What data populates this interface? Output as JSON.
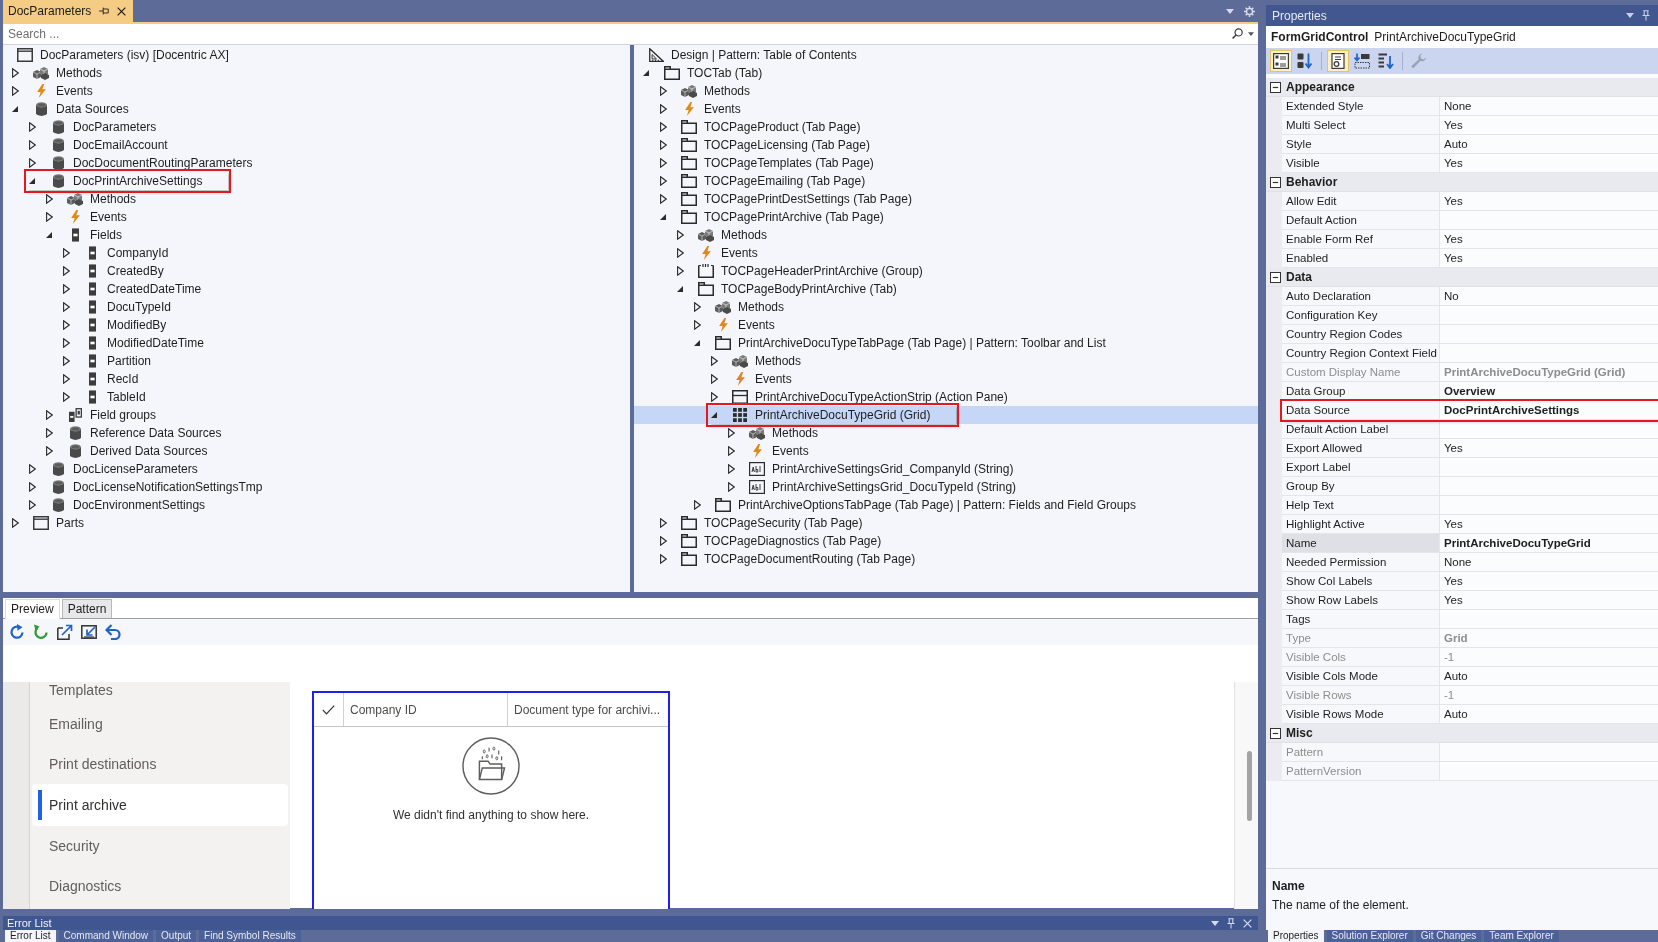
{
  "document_tabs": [
    {
      "label": "DocParameters",
      "selected": true
    }
  ],
  "search": {
    "placeholder": "Search ..."
  },
  "left_tree": {
    "root": {
      "label": "DocParameters (isv) [Docentric AX]",
      "kind": "window"
    },
    "items": [
      {
        "label": "Methods",
        "kind": "methods",
        "expanded": false,
        "selected": false,
        "highlighted": false
      },
      {
        "label": "Events",
        "kind": "events",
        "expanded": false,
        "selected": false,
        "highlighted": false
      },
      {
        "label": "Data Sources",
        "kind": "datasource",
        "expanded": true,
        "selected": false,
        "highlighted": false,
        "children": [
          {
            "label": "DocParameters",
            "kind": "datasource",
            "expanded": false,
            "selected": false,
            "highlighted": false
          },
          {
            "label": "DocEmailAccount",
            "kind": "datasource",
            "expanded": false,
            "selected": false,
            "highlighted": false
          },
          {
            "label": "DocDocumentRoutingParameters",
            "kind": "datasource",
            "expanded": false,
            "selected": false,
            "highlighted": false
          },
          {
            "label": "DocPrintArchiveSettings",
            "kind": "datasource",
            "expanded": true,
            "selected": false,
            "highlighted": true,
            "children": [
              {
                "label": "Methods",
                "kind": "methods",
                "expanded": false,
                "selected": false,
                "highlighted": false
              },
              {
                "label": "Events",
                "kind": "events",
                "expanded": false,
                "selected": false,
                "highlighted": false
              },
              {
                "label": "Fields",
                "kind": "field",
                "expanded": true,
                "selected": false,
                "highlighted": false,
                "children": [
                  {
                    "label": "CompanyId",
                    "kind": "field",
                    "expanded": false,
                    "selected": false,
                    "highlighted": false
                  },
                  {
                    "label": "CreatedBy",
                    "kind": "field",
                    "expanded": false,
                    "selected": false,
                    "highlighted": false
                  },
                  {
                    "label": "CreatedDateTime",
                    "kind": "field",
                    "expanded": false,
                    "selected": false,
                    "highlighted": false
                  },
                  {
                    "label": "DocuTypeId",
                    "kind": "field",
                    "expanded": false,
                    "selected": false,
                    "highlighted": false
                  },
                  {
                    "label": "ModifiedBy",
                    "kind": "field",
                    "expanded": false,
                    "selected": false,
                    "highlighted": false
                  },
                  {
                    "label": "ModifiedDateTime",
                    "kind": "field",
                    "expanded": false,
                    "selected": false,
                    "highlighted": false
                  },
                  {
                    "label": "Partition",
                    "kind": "field",
                    "expanded": false,
                    "selected": false,
                    "highlighted": false
                  },
                  {
                    "label": "RecId",
                    "kind": "field",
                    "expanded": false,
                    "selected": false,
                    "highlighted": false
                  },
                  {
                    "label": "TableId",
                    "kind": "field",
                    "expanded": false,
                    "selected": false,
                    "highlighted": false
                  }
                ]
              },
              {
                "label": "Field groups",
                "kind": "fieldgroup",
                "expanded": false,
                "selected": false,
                "highlighted": false
              },
              {
                "label": "Reference Data Sources",
                "kind": "datasource",
                "expanded": false,
                "selected": false,
                "highlighted": false
              },
              {
                "label": "Derived Data Sources",
                "kind": "datasource",
                "expanded": false,
                "selected": false,
                "highlighted": false
              }
            ]
          },
          {
            "label": "DocLicenseParameters",
            "kind": "datasource",
            "expanded": false,
            "selected": false,
            "highlighted": false
          },
          {
            "label": "DocLicenseNotificationSettingsTmp",
            "kind": "datasource",
            "expanded": false,
            "selected": false,
            "highlighted": false
          },
          {
            "label": "DocEnvironmentSettings",
            "kind": "datasource",
            "expanded": false,
            "selected": false,
            "highlighted": false
          }
        ]
      },
      {
        "label": "Parts",
        "kind": "window",
        "expanded": false,
        "selected": false,
        "highlighted": false
      }
    ]
  },
  "right_tree": {
    "root": {
      "label": "Design | Pattern: Table of Contents",
      "kind": "design"
    },
    "items": [
      {
        "label": "TOCTab (Tab)",
        "kind": "folder",
        "expanded": true,
        "selected": false,
        "highlighted": false,
        "children": [
          {
            "label": "Methods",
            "kind": "methods",
            "expanded": false,
            "selected": false,
            "highlighted": false
          },
          {
            "label": "Events",
            "kind": "events",
            "expanded": false,
            "selected": false,
            "highlighted": false
          },
          {
            "label": "TOCPageProduct (Tab Page)",
            "kind": "folder",
            "expanded": false,
            "selected": false,
            "highlighted": false
          },
          {
            "label": "TOCPageLicensing (Tab Page)",
            "kind": "folder",
            "expanded": false,
            "selected": false,
            "highlighted": false
          },
          {
            "label": "TOCPageTemplates (Tab Page)",
            "kind": "folder",
            "expanded": false,
            "selected": false,
            "highlighted": false
          },
          {
            "label": "TOCPageEmailing (Tab Page)",
            "kind": "folder",
            "expanded": false,
            "selected": false,
            "highlighted": false
          },
          {
            "label": "TOCPagePrintDestSettings (Tab Page)",
            "kind": "folder",
            "expanded": false,
            "selected": false,
            "highlighted": false
          },
          {
            "label": "TOCPagePrintArchive (Tab Page)",
            "kind": "folder",
            "expanded": true,
            "selected": false,
            "highlighted": false,
            "children": [
              {
                "label": "Methods",
                "kind": "methods",
                "expanded": false,
                "selected": false,
                "highlighted": false
              },
              {
                "label": "Events",
                "kind": "events",
                "expanded": false,
                "selected": false,
                "highlighted": false
              },
              {
                "label": "TOCPageHeaderPrintArchive (Group)",
                "kind": "group",
                "expanded": false,
                "selected": false,
                "highlighted": false
              },
              {
                "label": "TOCPageBodyPrintArchive (Tab)",
                "kind": "folder",
                "expanded": true,
                "selected": false,
                "highlighted": false,
                "children": [
                  {
                    "label": "Methods",
                    "kind": "methods",
                    "expanded": false,
                    "selected": false,
                    "highlighted": false
                  },
                  {
                    "label": "Events",
                    "kind": "events",
                    "expanded": false,
                    "selected": false,
                    "highlighted": false
                  },
                  {
                    "label": "PrintArchiveDocuTypeTabPage (Tab Page) | Pattern: Toolbar and List",
                    "kind": "folder",
                    "expanded": true,
                    "selected": false,
                    "highlighted": false,
                    "children": [
                      {
                        "label": "Methods",
                        "kind": "methods",
                        "expanded": false,
                        "selected": false,
                        "highlighted": false
                      },
                      {
                        "label": "Events",
                        "kind": "events",
                        "expanded": false,
                        "selected": false,
                        "highlighted": false
                      },
                      {
                        "label": "PrintArchiveDocuTypeActionStrip (Action Pane)",
                        "kind": "actionpane",
                        "expanded": false,
                        "selected": false,
                        "highlighted": false
                      },
                      {
                        "label": "PrintArchiveDocuTypeGrid (Grid)",
                        "kind": "grid",
                        "expanded": true,
                        "selected": true,
                        "highlighted": true,
                        "children": [
                          {
                            "label": "Methods",
                            "kind": "methods",
                            "expanded": false,
                            "selected": false,
                            "highlighted": false
                          },
                          {
                            "label": "Events",
                            "kind": "events",
                            "expanded": false,
                            "selected": false,
                            "highlighted": false
                          },
                          {
                            "label": "PrintArchiveSettingsGrid_CompanyId (String)",
                            "kind": "string",
                            "expanded": false,
                            "selected": false,
                            "highlighted": false
                          },
                          {
                            "label": "PrintArchiveSettingsGrid_DocuTypeId (String)",
                            "kind": "string",
                            "expanded": false,
                            "selected": false,
                            "highlighted": false
                          }
                        ]
                      }
                    ]
                  },
                  {
                    "label": "PrintArchiveOptionsTabPage (Tab Page) | Pattern: Fields and Field Groups",
                    "kind": "folder",
                    "expanded": false,
                    "selected": false,
                    "highlighted": false
                  }
                ]
              }
            ]
          },
          {
            "label": "TOCPageSecurity (Tab Page)",
            "kind": "folder",
            "expanded": false,
            "selected": false,
            "highlighted": false
          },
          {
            "label": "TOCPageDiagnostics (Tab Page)",
            "kind": "folder",
            "expanded": false,
            "selected": false,
            "highlighted": false
          },
          {
            "label": "TOCPageDocumentRouting (Tab Page)",
            "kind": "folder",
            "expanded": false,
            "selected": false,
            "highlighted": false
          }
        ]
      }
    ]
  },
  "preview": {
    "tabs": [
      {
        "label": "Preview",
        "selected": true
      },
      {
        "label": "Pattern",
        "selected": false
      }
    ],
    "nav": [
      {
        "label": "Templates",
        "selected": false
      },
      {
        "label": "Emailing",
        "selected": false
      },
      {
        "label": "Print destinations",
        "selected": false
      },
      {
        "label": "Print archive",
        "selected": true
      },
      {
        "label": "Security",
        "selected": false
      },
      {
        "label": "Diagnostics",
        "selected": false
      }
    ],
    "grid": {
      "columns": [
        "Company ID",
        "Document type for archivi..."
      ],
      "empty_message": "We didn't find anything to show here."
    }
  },
  "error_list": {
    "title": "Error List",
    "tabs": [
      {
        "label": "Error List",
        "selected": true
      },
      {
        "label": "Command Window",
        "selected": false
      },
      {
        "label": "Output",
        "selected": false
      },
      {
        "label": "Find Symbol Results",
        "selected": false
      }
    ]
  },
  "properties": {
    "title": "Properties",
    "object_type": "FormGridControl",
    "object_name": "PrintArchiveDocuTypeGrid",
    "toolbar": [
      {
        "kind": "categorized",
        "selected": true,
        "disabled": false
      },
      {
        "kind": "alphabetical",
        "selected": false,
        "disabled": false
      },
      {
        "kind": "property_pages",
        "selected": true,
        "disabled": false
      },
      {
        "kind": "events",
        "selected": false,
        "disabled": false
      },
      {
        "kind": "sort",
        "selected": false,
        "disabled": false
      },
      {
        "kind": "settings",
        "selected": false,
        "disabled": true
      }
    ],
    "categories": [
      {
        "name": "Appearance",
        "expanded": true,
        "rows": [
          {
            "label": "Extended Style",
            "value": "None",
            "modified": false,
            "read_only": false,
            "selected": false,
            "highlighted": false
          },
          {
            "label": "Multi Select",
            "value": "Yes",
            "modified": false,
            "read_only": false,
            "selected": false,
            "highlighted": false
          },
          {
            "label": "Style",
            "value": "Auto",
            "modified": false,
            "read_only": false,
            "selected": false,
            "highlighted": false
          },
          {
            "label": "Visible",
            "value": "Yes",
            "modified": false,
            "read_only": false,
            "selected": false,
            "highlighted": false
          }
        ]
      },
      {
        "name": "Behavior",
        "expanded": true,
        "rows": [
          {
            "label": "Allow Edit",
            "value": "Yes",
            "modified": false,
            "read_only": false,
            "selected": false,
            "highlighted": false
          },
          {
            "label": "Default Action",
            "read_only": false,
            "selected": false,
            "highlighted": false
          },
          {
            "label": "Enable Form Ref",
            "value": "Yes",
            "modified": false,
            "read_only": false,
            "selected": false,
            "highlighted": false
          },
          {
            "label": "Enabled",
            "value": "Yes",
            "modified": false,
            "read_only": false,
            "selected": false,
            "highlighted": false
          }
        ]
      },
      {
        "name": "Data",
        "expanded": true,
        "rows": [
          {
            "label": "Auto Declaration",
            "value": "No",
            "modified": false,
            "read_only": false,
            "selected": false,
            "highlighted": false
          },
          {
            "label": "Configuration Key",
            "read_only": false,
            "selected": false,
            "highlighted": false
          },
          {
            "label": "Country Region Codes",
            "read_only": false,
            "selected": false,
            "highlighted": false
          },
          {
            "label": "Country Region Context Field",
            "read_only": false,
            "selected": false,
            "highlighted": false
          },
          {
            "label": "Custom Display Name",
            "value": "PrintArchiveDocuTypeGrid (Grid)",
            "modified": true,
            "read_only": true,
            "selected": false,
            "highlighted": false
          },
          {
            "label": "Data Group",
            "value": "Overview",
            "modified": true,
            "read_only": false,
            "selected": false,
            "highlighted": false
          },
          {
            "label": "Data Source",
            "value": "DocPrintArchiveSettings",
            "modified": true,
            "read_only": false,
            "selected": false,
            "highlighted": true
          },
          {
            "label": "Default Action Label",
            "read_only": false,
            "selected": false,
            "highlighted": false
          },
          {
            "label": "Export Allowed",
            "value": "Yes",
            "modified": false,
            "read_only": false,
            "selected": false,
            "highlighted": false
          },
          {
            "label": "Export Label",
            "read_only": false,
            "selected": false,
            "highlighted": false
          },
          {
            "label": "Group By",
            "read_only": false,
            "selected": false,
            "highlighted": false
          },
          {
            "label": "Help Text",
            "read_only": false,
            "selected": false,
            "highlighted": false
          },
          {
            "label": "Highlight Active",
            "value": "Yes",
            "modified": false,
            "read_only": false,
            "selected": false,
            "highlighted": false
          },
          {
            "label": "Name",
            "value": "PrintArchiveDocuTypeGrid",
            "modified": true,
            "read_only": false,
            "selected": true,
            "highlighted": false
          },
          {
            "label": "Needed Permission",
            "value": "None",
            "modified": false,
            "read_only": false,
            "selected": false,
            "highlighted": false
          },
          {
            "label": "Show Col Labels",
            "value": "Yes",
            "modified": false,
            "read_only": false,
            "selected": false,
            "highlighted": false
          },
          {
            "label": "Show Row Labels",
            "value": "Yes",
            "modified": false,
            "read_only": false,
            "selected": false,
            "highlighted": false
          },
          {
            "label": "Tags",
            "read_only": false,
            "selected": false,
            "highlighted": false
          },
          {
            "label": "Type",
            "value": "Grid",
            "modified": true,
            "read_only": true,
            "selected": false,
            "highlighted": false
          },
          {
            "label": "Visible Cols",
            "value": "-1",
            "modified": false,
            "read_only": true,
            "selected": false,
            "highlighted": false
          },
          {
            "label": "Visible Cols Mode",
            "value": "Auto",
            "modified": false,
            "read_only": false,
            "selected": false,
            "highlighted": false
          },
          {
            "label": "Visible Rows",
            "value": "-1",
            "modified": false,
            "read_only": true,
            "selected": false,
            "highlighted": false
          },
          {
            "label": "Visible Rows Mode",
            "value": "Auto",
            "modified": false,
            "read_only": false,
            "selected": false,
            "highlighted": false
          }
        ]
      },
      {
        "name": "Misc",
        "expanded": true,
        "rows": [
          {
            "label": "Pattern",
            "read_only": true,
            "selected": false,
            "highlighted": false
          },
          {
            "label": "PatternVersion",
            "read_only": true,
            "selected": false,
            "highlighted": false
          }
        ]
      }
    ],
    "description": {
      "title": "Name",
      "text": "The name of the element."
    },
    "tabs": [
      {
        "label": "Properties",
        "selected": true
      },
      {
        "label": "Solution Explorer",
        "selected": false
      },
      {
        "label": "Git Changes",
        "selected": false
      },
      {
        "label": "Team Explorer",
        "selected": false
      }
    ]
  }
}
